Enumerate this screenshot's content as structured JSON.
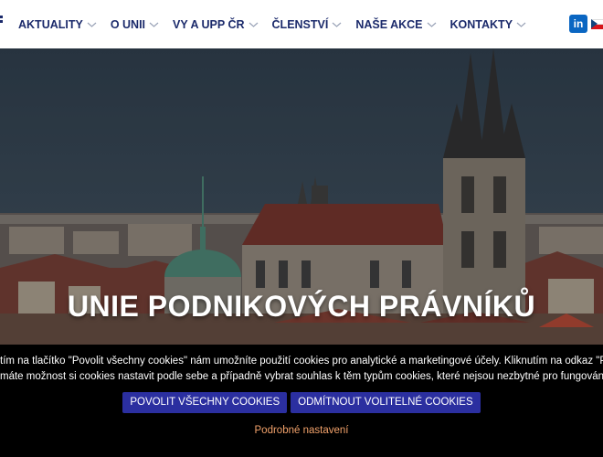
{
  "nav": {
    "items": [
      {
        "label": "AKTUALITY",
        "has_dropdown": true
      },
      {
        "label": "O UNII",
        "has_dropdown": true
      },
      {
        "label": "VY A UPP ČR",
        "has_dropdown": true
      },
      {
        "label": "ČLENSTVÍ",
        "has_dropdown": true
      },
      {
        "label": "NAŠE AKCE",
        "has_dropdown": true
      },
      {
        "label": "KONTAKTY",
        "has_dropdown": true
      }
    ],
    "social_icon": "linkedin-icon",
    "social_label": "in",
    "language_icon": "czech-flag-icon"
  },
  "hero": {
    "title": "UNIE PODNIKOVÝCH PRÁVNÍKŮ"
  },
  "cookie": {
    "line1": "tím na tlačítko \"Povolit všechny cookies\" nám umožníte použití cookies pro analytické a marketingové účely. Kliknutím na odkaz \"Podrobné nast",
    "line2": "máte možnost si cookies nastavit podle sebe a případně vybrat souhlas k těm typům cookies, které nejsou nezbytné pro fungování webu.",
    "accept_label": "POVOLIT VŠECHNY COOKIES",
    "reject_label": "ODMÍTNOUT VOLITELNÉ COOKIES",
    "settings_label": "Podrobné nastavení"
  },
  "colors": {
    "nav_text": "#1b2a6b",
    "button_bg": "#2b2fa0",
    "link_accent": "#f2a26b",
    "cookie_bg": "#000000"
  }
}
